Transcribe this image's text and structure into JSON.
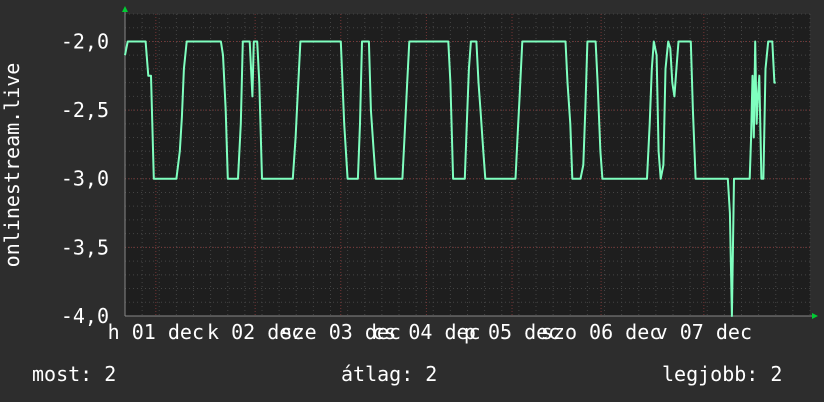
{
  "chart_data": {
    "type": "line",
    "ylabel": "onlinestream.live",
    "ylim": [
      -4.0,
      -1.8
    ],
    "yticks": [
      "-2,0",
      "-2,5",
      "-3,0",
      "-3,5",
      "-4,0"
    ],
    "ytick_values": [
      -2.0,
      -2.5,
      -3.0,
      -3.5,
      -4.0
    ],
    "xlim": [
      0,
      100
    ],
    "xticks": [
      {
        "label": "h 01 dec",
        "x": 4.5
      },
      {
        "label": "k 02 dec",
        "x": 19.0
      },
      {
        "label": "sze 03 dec",
        "x": 31.5
      },
      {
        "label": "cs 04 dec",
        "x": 44.0
      },
      {
        "label": "p 05 dec",
        "x": 56.5
      },
      {
        "label": "szo 06 dec",
        "x": 69.5
      },
      {
        "label": "v 07 dec",
        "x": 84.5
      }
    ],
    "grid": true,
    "series": [
      {
        "color": "#7fffbf",
        "points": [
          [
            0.0,
            -2.1
          ],
          [
            0.4,
            -2.0
          ],
          [
            3.0,
            -2.0
          ],
          [
            3.4,
            -2.25
          ],
          [
            3.8,
            -2.25
          ],
          [
            4.2,
            -3.0
          ],
          [
            7.5,
            -3.0
          ],
          [
            8.0,
            -2.8
          ],
          [
            8.3,
            -2.55
          ],
          [
            8.6,
            -2.2
          ],
          [
            9.0,
            -2.0
          ],
          [
            14.0,
            -2.0
          ],
          [
            14.3,
            -2.1
          ],
          [
            14.7,
            -2.5
          ],
          [
            15.0,
            -3.0
          ],
          [
            16.5,
            -3.0
          ],
          [
            16.9,
            -2.6
          ],
          [
            17.2,
            -2.0
          ],
          [
            18.2,
            -2.0
          ],
          [
            18.6,
            -2.4
          ],
          [
            18.8,
            -2.0
          ],
          [
            19.3,
            -2.0
          ],
          [
            19.6,
            -2.3
          ],
          [
            20.0,
            -3.0
          ],
          [
            24.5,
            -3.0
          ],
          [
            24.9,
            -2.7
          ],
          [
            25.2,
            -2.4
          ],
          [
            25.6,
            -2.0
          ],
          [
            31.5,
            -2.0
          ],
          [
            32.0,
            -2.6
          ],
          [
            32.5,
            -3.0
          ],
          [
            34.0,
            -3.0
          ],
          [
            34.3,
            -2.6
          ],
          [
            34.6,
            -2.0
          ],
          [
            35.6,
            -2.0
          ],
          [
            35.9,
            -2.5
          ],
          [
            36.3,
            -2.8
          ],
          [
            36.6,
            -3.0
          ],
          [
            40.5,
            -3.0
          ],
          [
            40.8,
            -2.7
          ],
          [
            41.2,
            -2.3
          ],
          [
            41.5,
            -2.0
          ],
          [
            47.2,
            -2.0
          ],
          [
            47.5,
            -2.3
          ],
          [
            47.9,
            -3.0
          ],
          [
            49.6,
            -3.0
          ],
          [
            49.9,
            -2.6
          ],
          [
            50.2,
            -2.2
          ],
          [
            50.5,
            -2.0
          ],
          [
            51.3,
            -2.0
          ],
          [
            51.6,
            -2.3
          ],
          [
            51.9,
            -2.5
          ],
          [
            52.3,
            -2.8
          ],
          [
            52.6,
            -3.0
          ],
          [
            57.0,
            -3.0
          ],
          [
            57.3,
            -2.7
          ],
          [
            57.6,
            -2.4
          ],
          [
            58.0,
            -2.0
          ],
          [
            64.3,
            -2.0
          ],
          [
            64.6,
            -2.3
          ],
          [
            65.0,
            -2.6
          ],
          [
            65.3,
            -3.0
          ],
          [
            66.5,
            -3.0
          ],
          [
            66.9,
            -2.9
          ],
          [
            67.2,
            -2.5
          ],
          [
            67.5,
            -2.0
          ],
          [
            68.7,
            -2.0
          ],
          [
            69.0,
            -2.3
          ],
          [
            69.4,
            -2.8
          ],
          [
            69.7,
            -3.0
          ],
          [
            76.2,
            -3.0
          ],
          [
            76.6,
            -2.6
          ],
          [
            76.9,
            -2.2
          ],
          [
            77.2,
            -2.0
          ],
          [
            77.6,
            -2.1
          ],
          [
            77.9,
            -2.8
          ],
          [
            78.2,
            -3.0
          ],
          [
            78.6,
            -2.9
          ],
          [
            78.9,
            -2.2
          ],
          [
            79.3,
            -2.0
          ],
          [
            79.6,
            -2.05
          ],
          [
            79.9,
            -2.3
          ],
          [
            80.2,
            -2.4
          ],
          [
            80.5,
            -2.2
          ],
          [
            80.8,
            -2.0
          ],
          [
            82.6,
            -2.0
          ],
          [
            82.9,
            -2.5
          ],
          [
            83.3,
            -3.0
          ],
          [
            88.0,
            -3.0
          ],
          [
            88.3,
            -3.25
          ],
          [
            88.6,
            -4.0
          ],
          [
            88.9,
            -3.0
          ],
          [
            89.3,
            -3.0
          ],
          [
            91.2,
            -3.0
          ],
          [
            91.4,
            -2.7
          ],
          [
            91.6,
            -2.25
          ],
          [
            91.8,
            -2.7
          ],
          [
            92.0,
            -2.0
          ],
          [
            92.2,
            -2.6
          ],
          [
            92.4,
            -2.4
          ],
          [
            92.6,
            -2.25
          ],
          [
            92.9,
            -3.0
          ],
          [
            93.2,
            -3.0
          ],
          [
            93.5,
            -2.2
          ],
          [
            93.9,
            -2.0
          ],
          [
            94.5,
            -2.0
          ],
          [
            94.8,
            -2.3
          ],
          [
            95.0,
            -2.3
          ]
        ]
      }
    ]
  },
  "footer": {
    "most": "most: 2",
    "average": "átlag: 2",
    "best": "legjobb: 2"
  },
  "colors": {
    "background": "#2d2d2d",
    "plot_background": "#1e1e1e",
    "grid": "#5a5a5a",
    "grid_minor": "#444444",
    "axis_arrow": "#00cc33",
    "text": "#ffffff"
  }
}
